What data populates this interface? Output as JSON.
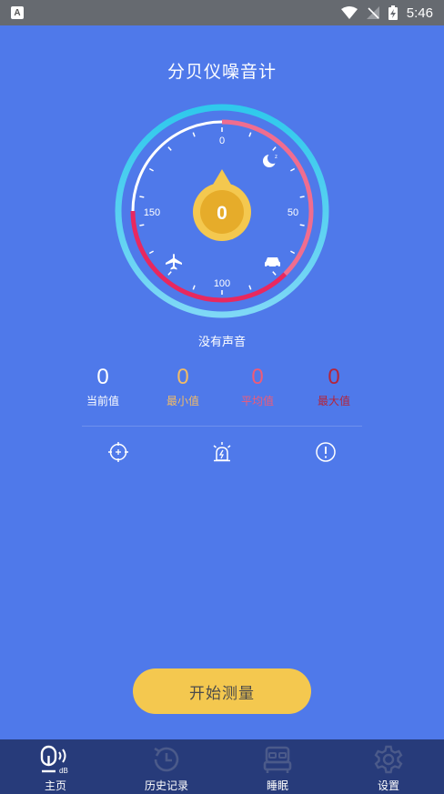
{
  "status_bar": {
    "app_letter": "A",
    "time": "5:46"
  },
  "header": {
    "title": "分贝仪噪音计"
  },
  "gauge": {
    "ticks": {
      "zero": "0",
      "fifty": "50",
      "hundred": "100",
      "one_fifty": "150"
    },
    "value": "0",
    "icons": [
      "moon-sleep-icon",
      "car-icon",
      "airplane-icon"
    ]
  },
  "status_text": "没有声音",
  "stats": {
    "current": {
      "value": "0",
      "label": "当前值",
      "color": "#ffffff"
    },
    "min": {
      "value": "0",
      "label": "最小值",
      "color": "#f2bb66"
    },
    "avg": {
      "value": "0",
      "label": "平均值",
      "color": "#ef5b77"
    },
    "max": {
      "value": "0",
      "label": "最大值",
      "color": "#b5243a"
    }
  },
  "tools": [
    "calibrate-icon",
    "alarm-icon",
    "info-icon"
  ],
  "start_button": {
    "label": "开始测量"
  },
  "tabbar": {
    "items": [
      {
        "label": "主页",
        "icon": "mic-db-icon",
        "active": true
      },
      {
        "label": "历史记录",
        "icon": "history-clock-icon",
        "active": false
      },
      {
        "label": "睡眠",
        "icon": "bed-icon",
        "active": false
      },
      {
        "label": "设置",
        "icon": "gear-icon",
        "active": false
      }
    ]
  },
  "colors": {
    "background": "#4f79ea",
    "accent_yellow": "#f4c84f",
    "ring_cyan": "#37c6ee",
    "ring_pink": "#f06d8f",
    "ring_red": "#e8285f",
    "tabbar": "#273b7a"
  }
}
